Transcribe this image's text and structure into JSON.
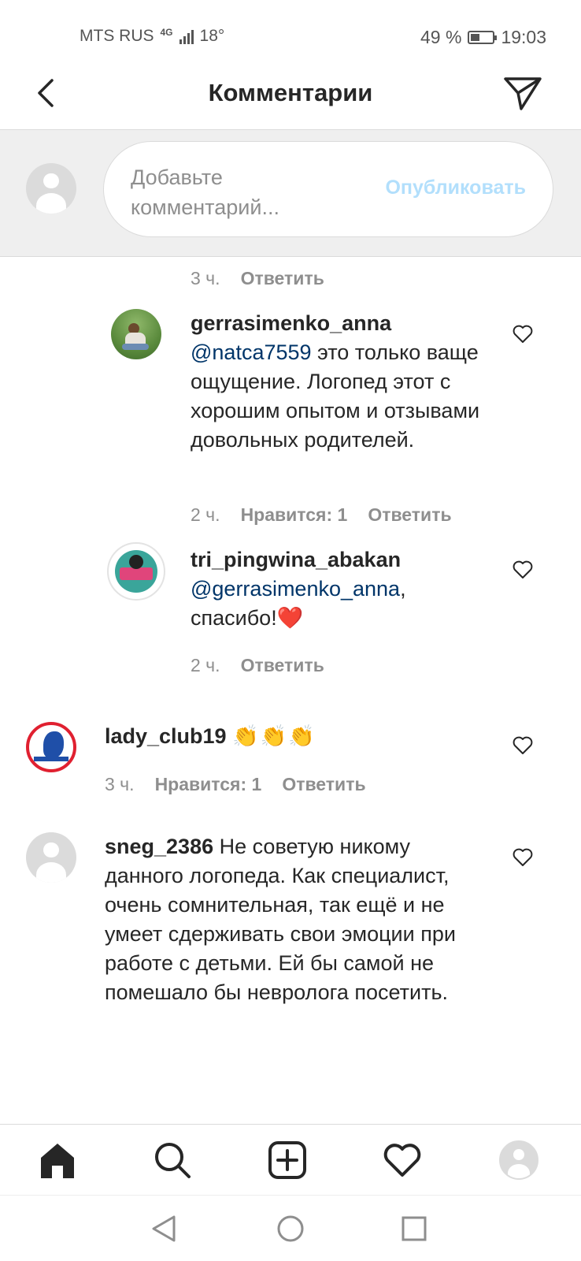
{
  "status_bar": {
    "carrier": "MTS RUS",
    "network": "4G",
    "temperature": "18°",
    "battery": "49 %",
    "battery_level": 0.49,
    "time": "19:03"
  },
  "header": {
    "title": "Комментарии",
    "back_icon": "back-arrow-icon",
    "send_icon": "direct-send-icon"
  },
  "composer": {
    "placeholder_line1": "Добавьте",
    "placeholder_line2": "комментарий...",
    "publish_label": "Опубликовать"
  },
  "comments": [
    {
      "id": "top-meta",
      "time": "3 ч.",
      "reply": "Ответить"
    },
    {
      "user": "gerrasimenko_anna",
      "mention": "@natca7559",
      "text": " это только ваще ощущение. Логопед этот с хорошим опытом и отзывами довольных родителей.",
      "time": "2 ч.",
      "likes": "Нравится: 1",
      "reply": "Ответить"
    },
    {
      "user": "tri_pingwina_abakan",
      "mention": "@gerrasimenko_anna",
      "text": ", спасибо!",
      "emoji": "❤️",
      "time": "2 ч.",
      "reply": "Ответить"
    },
    {
      "user": "lady_club19",
      "text": "👏👏👏",
      "time": "3 ч.",
      "likes": "Нравится: 1",
      "reply": "Ответить"
    },
    {
      "user": "sneg_2386",
      "text": " Не советую никому данного логопеда. Как специалист, очень сомнительная, так ещё и не умеет сдерживать свои эмоции при работе с детьми. Ей бы самой не помешало бы невролога посетить."
    }
  ],
  "bottom_nav": [
    "home-icon",
    "search-icon",
    "new-post-icon",
    "activity-icon",
    "profile-icon"
  ],
  "system_nav": [
    "back-triangle-icon",
    "home-circle-icon",
    "recents-square-icon"
  ],
  "colors": {
    "accent_disabled": "#b2dffc",
    "mention": "#003569",
    "text": "#262626",
    "muted": "#8e8e8e"
  }
}
